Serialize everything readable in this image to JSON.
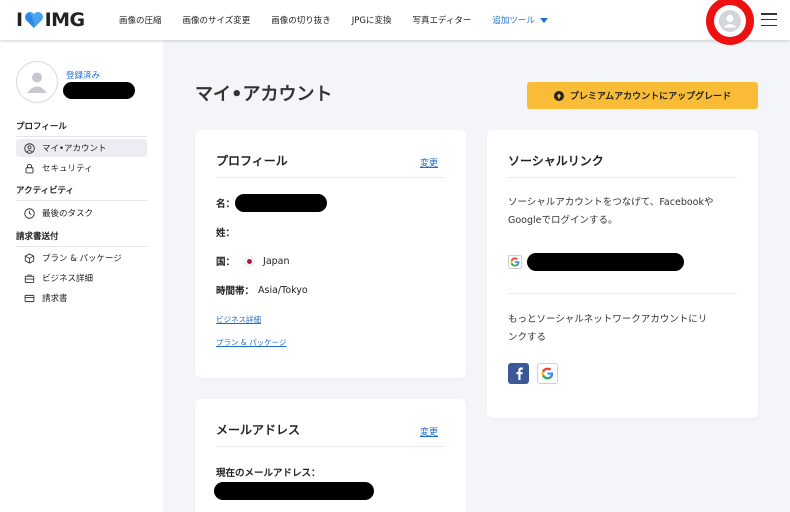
{
  "header": {
    "logo_left": "I",
    "logo_right": "IMG",
    "nav": [
      {
        "label": "画像の圧縮"
      },
      {
        "label": "画像のサイズ変更"
      },
      {
        "label": "画像の切り抜き"
      },
      {
        "label": "JPGに変換"
      },
      {
        "label": "写真エディター"
      },
      {
        "label": "追加ツール"
      }
    ]
  },
  "sidebar": {
    "registered_label": "登録済み",
    "sections": {
      "profile": "プロフィール",
      "activity": "アクティビティ",
      "billing": "請求書送付"
    },
    "items": {
      "my_account": "マイ•アカウント",
      "security": "セキュリティ",
      "last_tasks": "最後のタスク",
      "plans": "プラン & パッケージ",
      "business": "ビジネス詳細",
      "invoices": "請求書"
    }
  },
  "main": {
    "title": "マイ•アカウント",
    "premium_button": "プレミアムアカウントにアップグレード",
    "profile_card": {
      "title": "プロフィール",
      "edit": "変更",
      "name_label": "名：",
      "surname_label": "姓：",
      "country_label": "国：",
      "country_value": "Japan",
      "timezone_label": "時間帯：",
      "timezone_value": "Asia/Tokyo",
      "business_link": "ビジネス詳細",
      "plans_link": "プラン & パッケージ"
    },
    "email_card": {
      "title": "メールアドレス",
      "edit": "変更",
      "current_label": "現在のメールアドレス："
    },
    "social_card": {
      "title": "ソーシャルリンク",
      "desc_line1": "ソーシャルアカウントをつなげて、Facebookや",
      "desc_line2": "Googleでログインする。",
      "more_line1": "もっとソーシャルネットワークアカウントにリ",
      "more_line2": "ンクする"
    }
  },
  "colors": {
    "accent": "#1c6fd1",
    "premium": "#f8bc36",
    "highlight_ring": "#ee1111",
    "facebook": "#3b5998"
  }
}
